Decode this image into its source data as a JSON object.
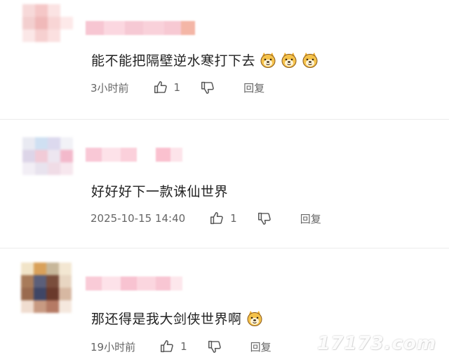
{
  "comments": [
    {
      "text": "能不能把隔壁逆水寒打下去",
      "emojis": [
        "doge-emoji",
        "doge-emoji",
        "doge-emoji"
      ],
      "time": "3小时前",
      "likes": "1",
      "reply_label": "回复",
      "avatar_colors": [
        "#f7d9d9",
        "#f5c7c7",
        "#fbe3e3",
        "#ffffff",
        "#f3cfcf",
        "#f0b9b9",
        "#f8d5d5",
        "#fde9e9",
        "#fbe7e7",
        "#f6d0d0",
        "#fbe0e0",
        "#ffffff",
        "#ffffff",
        "#ffffff",
        "#ffffff",
        "#ffffff"
      ],
      "name_colors": [
        "#f7c6d2",
        "#fbd7e0",
        "#f6c9d4",
        "#f9d1da",
        "#f7c9d3",
        "#f4b6a6"
      ]
    },
    {
      "text": "好好好下一款诛仙世界",
      "emojis": [],
      "time": "2025-10-15 14:40",
      "likes": "1",
      "reply_label": "回复",
      "avatar_colors": [
        "#e9eaf2",
        "#cfe0f2",
        "#dcd9ee",
        "#f2f2f7",
        "#ddd5e8",
        "#f1cbd7",
        "#ede6f0",
        "#f3b9cb",
        "#f2eef5",
        "#e8e3ee",
        "#f0dce6",
        "#f7e7ee",
        "#ffffff",
        "#ffffff",
        "#ffffff",
        "#ffffff"
      ],
      "name_colors": [
        "#f9c8d6",
        "#fde2e9",
        "#fbd0db",
        "#ffffff",
        "#fac1cf",
        "#fde4ea"
      ]
    },
    {
      "text": "那还得是我大剑侠世界啊",
      "emojis": [
        "doge-emoji"
      ],
      "time": "19小时前",
      "likes": "1",
      "reply_label": "回复",
      "avatar_colors": [
        "#f1e4c8",
        "#d9a15a",
        "#c7b79a",
        "#f3e7d2",
        "#a87b5a",
        "#5b5f7a",
        "#7a4e3c",
        "#e8d6c2",
        "#9a6b4f",
        "#3f4666",
        "#6a3a2c",
        "#d7b8a2",
        "#f0ddd0",
        "#c89a82",
        "#b57a64",
        "#f5e8de"
      ],
      "name_colors": [
        "#f9cbd7",
        "#fde2e9",
        "#f8c3d1",
        "#fbd6df",
        "#f8c6d3",
        "#fde7ec"
      ]
    }
  ],
  "watermark": "17173.com",
  "colors": {
    "text": "#222222",
    "meta": "#666666",
    "divider": "#ececec"
  }
}
